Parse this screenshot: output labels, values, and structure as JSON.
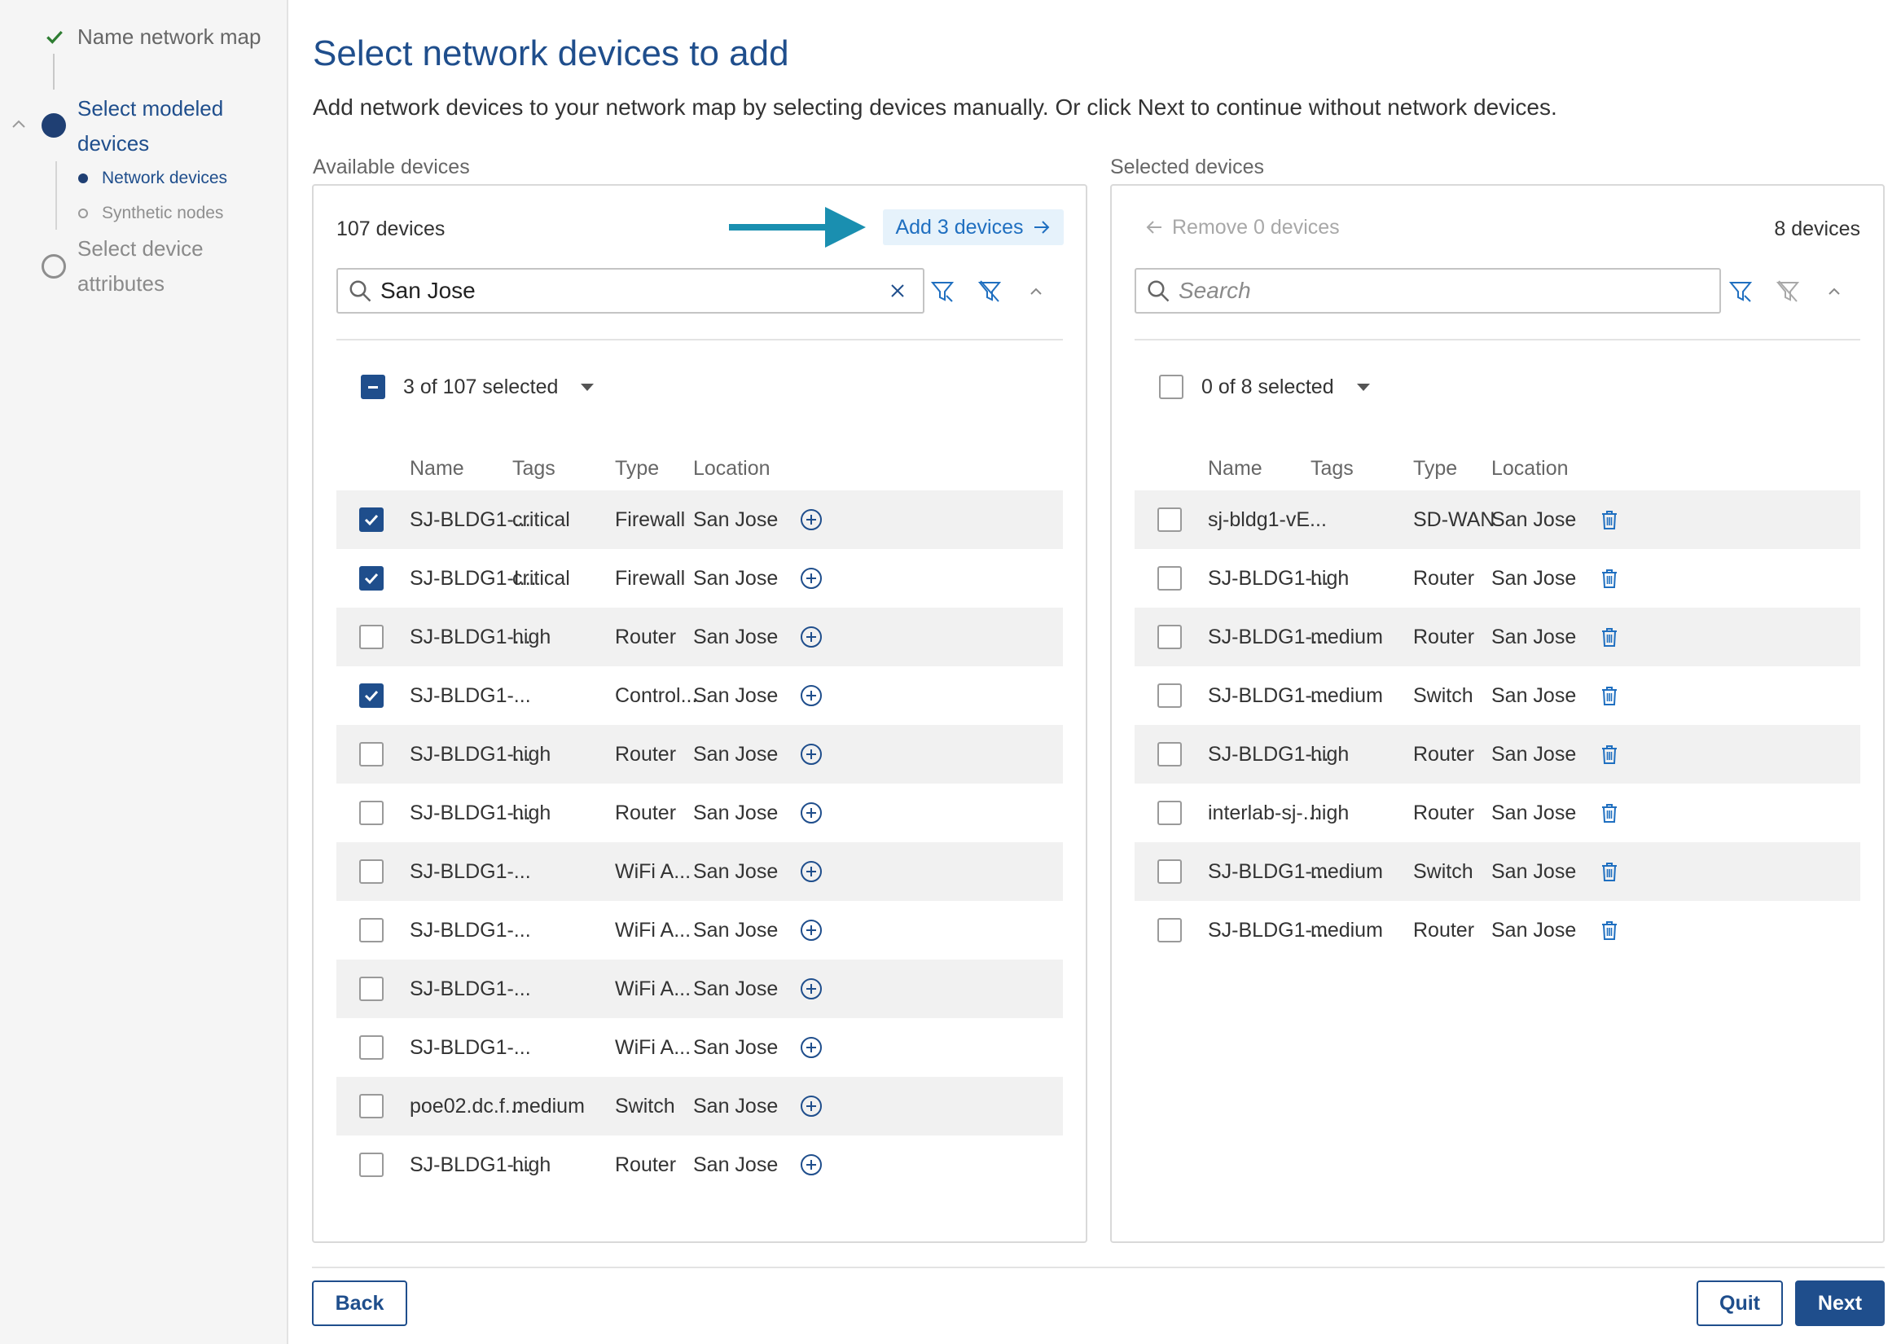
{
  "sidebar": {
    "steps": [
      {
        "label": "Name network map",
        "state": "done"
      },
      {
        "label_line1": "Select modeled",
        "label_line2": "devices",
        "state": "active"
      },
      {
        "label_line1": "Select device",
        "label_line2": "attributes",
        "state": "pending"
      }
    ],
    "substeps": [
      {
        "label": "Network devices",
        "state": "active"
      },
      {
        "label": "Synthetic nodes",
        "state": "pending"
      }
    ]
  },
  "page": {
    "title": "Select network devices to add",
    "subtitle": "Add network devices to your network map by selecting devices manually. Or click Next to continue without network devices."
  },
  "available": {
    "label": "Available devices",
    "count": "107 devices",
    "add_label": "Add 3 devices",
    "search_value": "San Jose",
    "selection_text": "3 of 107 selected",
    "columns": {
      "name": "Name",
      "tags": "Tags",
      "type": "Type",
      "location": "Location"
    },
    "rows": [
      {
        "name": "SJ-BLDG1-...",
        "tags": "critical",
        "type": "Firewall",
        "location": "San Jose",
        "checked": true
      },
      {
        "name": "SJ-BLDG1-I...",
        "tags": "critical",
        "type": "Firewall",
        "location": "San Jose",
        "checked": true
      },
      {
        "name": "SJ-BLDG1-...",
        "tags": "high",
        "type": "Router",
        "location": "San Jose",
        "checked": false
      },
      {
        "name": "SJ-BLDG1-...",
        "tags": "",
        "type": "Control...",
        "location": "San Jose",
        "checked": true
      },
      {
        "name": "SJ-BLDG1-...",
        "tags": "high",
        "type": "Router",
        "location": "San Jose",
        "checked": false
      },
      {
        "name": "SJ-BLDG1-...",
        "tags": "high",
        "type": "Router",
        "location": "San Jose",
        "checked": false
      },
      {
        "name": "SJ-BLDG1-...",
        "tags": "",
        "type": "WiFi A...",
        "location": "San Jose",
        "checked": false
      },
      {
        "name": "SJ-BLDG1-...",
        "tags": "",
        "type": "WiFi A...",
        "location": "San Jose",
        "checked": false
      },
      {
        "name": "SJ-BLDG1-...",
        "tags": "",
        "type": "WiFi A...",
        "location": "San Jose",
        "checked": false
      },
      {
        "name": "SJ-BLDG1-...",
        "tags": "",
        "type": "WiFi A...",
        "location": "San Jose",
        "checked": false
      },
      {
        "name": "poe02.dc.f...",
        "tags": "medium",
        "type": "Switch",
        "location": "San Jose",
        "checked": false
      },
      {
        "name": "SJ-BLDG1-...",
        "tags": "high",
        "type": "Router",
        "location": "San Jose",
        "checked": false
      }
    ]
  },
  "selected": {
    "label": "Selected devices",
    "count": "8 devices",
    "remove_label": "Remove 0 devices",
    "search_placeholder": "Search",
    "selection_text": "0 of 8 selected",
    "columns": {
      "name": "Name",
      "tags": "Tags",
      "type": "Type",
      "location": "Location"
    },
    "rows": [
      {
        "name": "sj-bldg1-vE...",
        "tags": "",
        "type": "SD-WAN",
        "location": "San Jose",
        "checked": false
      },
      {
        "name": "SJ-BLDG1-...",
        "tags": "high",
        "type": "Router",
        "location": "San Jose",
        "checked": false
      },
      {
        "name": "SJ-BLDG1-...",
        "tags": "medium",
        "type": "Router",
        "location": "San Jose",
        "checked": false
      },
      {
        "name": "SJ-BLDG1-...",
        "tags": "medium",
        "type": "Switch",
        "location": "San Jose",
        "checked": false
      },
      {
        "name": "SJ-BLDG1-...",
        "tags": "high",
        "type": "Router",
        "location": "San Jose",
        "checked": false
      },
      {
        "name": "interlab-sj-...",
        "tags": "high",
        "type": "Router",
        "location": "San Jose",
        "checked": false
      },
      {
        "name": "SJ-BLDG1-...",
        "tags": "medium",
        "type": "Switch",
        "location": "San Jose",
        "checked": false
      },
      {
        "name": "SJ-BLDG1-...",
        "tags": "medium",
        "type": "Router",
        "location": "San Jose",
        "checked": false
      }
    ]
  },
  "footer": {
    "back_label": "Back",
    "quit_label": "Quit",
    "next_label": "Next"
  },
  "colors": {
    "brand": "#1f4e8c",
    "accent_link": "#1f6fc0",
    "annotation_arrow": "#1a8fb0",
    "step_done_check": "#2e7d32"
  }
}
